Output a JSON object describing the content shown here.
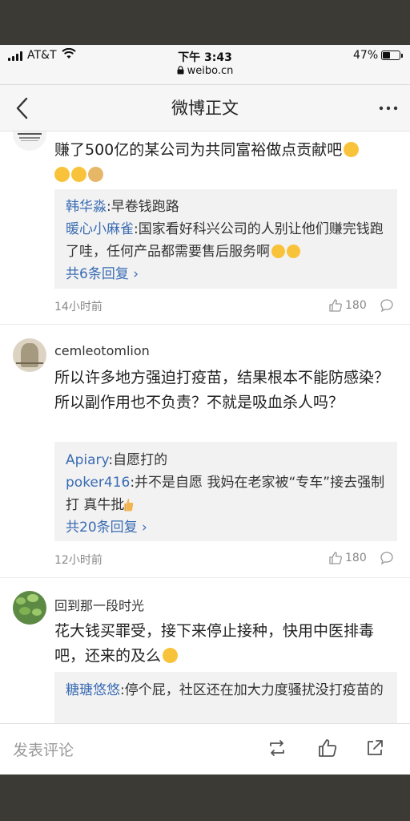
{
  "status_bar": {
    "carrier": "AT&T",
    "time": "下午 3:43",
    "url": "weibo.cn",
    "battery_percent": "47%",
    "battery_level": 0.47
  },
  "nav": {
    "title": "微博正文",
    "back_icon": "chevron-left-icon",
    "more_icon": "more-dots-icon"
  },
  "comments": [
    {
      "text": "赚了500亿的某公司为共同富裕做点贡献吧",
      "emoji_line1": [
        "yum-emoji"
      ],
      "emoji_line2": [
        "yum-emoji",
        "hug-emoji",
        "doge-emoji"
      ],
      "replies": [
        {
          "user": "韩华淼",
          "text": ":早卷钱跑路"
        },
        {
          "user": "暖心小麻雀",
          "text": ":国家看好科兴公司的人别让他们赚完钱跑了哇，任何产品都需要售后服务啊"
        }
      ],
      "more_replies": "共6条回复",
      "time": "14小时前",
      "likes": "180"
    },
    {
      "username": "cemleotomlion",
      "text": "所以许多地方强迫打疫苗，结果根本不能防感染？所以副作用也不负责？不就是吸血杀人吗？",
      "replies": [
        {
          "user": "Apiary",
          "text": ":自愿打的"
        },
        {
          "user": "poker416",
          "text": ":并不是自愿 我妈在老家被“专车”接去强制打 真牛批"
        }
      ],
      "more_replies": "共20条回复",
      "time": "12小时前",
      "likes": "180"
    },
    {
      "username": "回到那一段时光",
      "text": "花大钱买罪受，接下来停止接种，快用中医排毒吧，还来的及么",
      "replies": [
        {
          "user": "糖瑭悠悠",
          "text": ":停个屁，社区还在加大力度骚扰没打疫苗的"
        }
      ]
    }
  ],
  "bottom_bar": {
    "comment_placeholder": "发表评论",
    "icons": [
      "repost-icon",
      "like-icon",
      "share-icon"
    ]
  },
  "colors": {
    "link_blue": "#3a6cb4",
    "reply_bg": "#f2f2f2",
    "meta_gray": "#888888"
  }
}
